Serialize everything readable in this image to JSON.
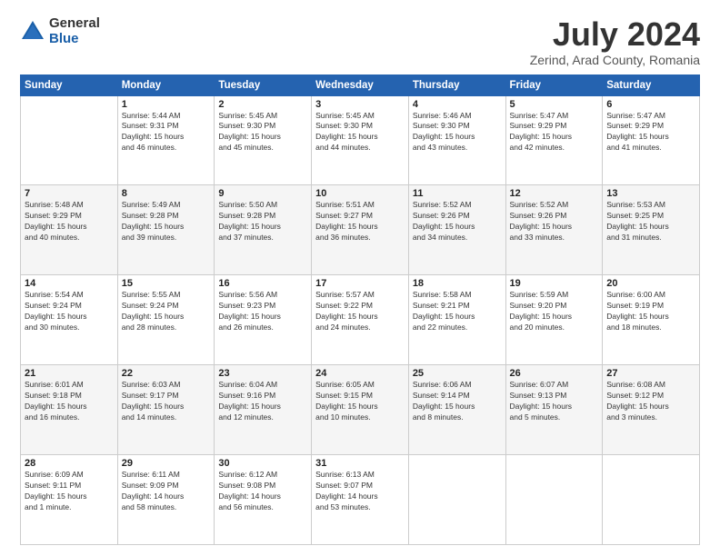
{
  "logo": {
    "general": "General",
    "blue": "Blue"
  },
  "title": "July 2024",
  "subtitle": "Zerind, Arad County, Romania",
  "weekdays": [
    "Sunday",
    "Monday",
    "Tuesday",
    "Wednesday",
    "Thursday",
    "Friday",
    "Saturday"
  ],
  "weeks": [
    [
      {
        "day": "",
        "info": ""
      },
      {
        "day": "1",
        "info": "Sunrise: 5:44 AM\nSunset: 9:31 PM\nDaylight: 15 hours\nand 46 minutes."
      },
      {
        "day": "2",
        "info": "Sunrise: 5:45 AM\nSunset: 9:30 PM\nDaylight: 15 hours\nand 45 minutes."
      },
      {
        "day": "3",
        "info": "Sunrise: 5:45 AM\nSunset: 9:30 PM\nDaylight: 15 hours\nand 44 minutes."
      },
      {
        "day": "4",
        "info": "Sunrise: 5:46 AM\nSunset: 9:30 PM\nDaylight: 15 hours\nand 43 minutes."
      },
      {
        "day": "5",
        "info": "Sunrise: 5:47 AM\nSunset: 9:29 PM\nDaylight: 15 hours\nand 42 minutes."
      },
      {
        "day": "6",
        "info": "Sunrise: 5:47 AM\nSunset: 9:29 PM\nDaylight: 15 hours\nand 41 minutes."
      }
    ],
    [
      {
        "day": "7",
        "info": "Sunrise: 5:48 AM\nSunset: 9:29 PM\nDaylight: 15 hours\nand 40 minutes."
      },
      {
        "day": "8",
        "info": "Sunrise: 5:49 AM\nSunset: 9:28 PM\nDaylight: 15 hours\nand 39 minutes."
      },
      {
        "day": "9",
        "info": "Sunrise: 5:50 AM\nSunset: 9:28 PM\nDaylight: 15 hours\nand 37 minutes."
      },
      {
        "day": "10",
        "info": "Sunrise: 5:51 AM\nSunset: 9:27 PM\nDaylight: 15 hours\nand 36 minutes."
      },
      {
        "day": "11",
        "info": "Sunrise: 5:52 AM\nSunset: 9:26 PM\nDaylight: 15 hours\nand 34 minutes."
      },
      {
        "day": "12",
        "info": "Sunrise: 5:52 AM\nSunset: 9:26 PM\nDaylight: 15 hours\nand 33 minutes."
      },
      {
        "day": "13",
        "info": "Sunrise: 5:53 AM\nSunset: 9:25 PM\nDaylight: 15 hours\nand 31 minutes."
      }
    ],
    [
      {
        "day": "14",
        "info": "Sunrise: 5:54 AM\nSunset: 9:24 PM\nDaylight: 15 hours\nand 30 minutes."
      },
      {
        "day": "15",
        "info": "Sunrise: 5:55 AM\nSunset: 9:24 PM\nDaylight: 15 hours\nand 28 minutes."
      },
      {
        "day": "16",
        "info": "Sunrise: 5:56 AM\nSunset: 9:23 PM\nDaylight: 15 hours\nand 26 minutes."
      },
      {
        "day": "17",
        "info": "Sunrise: 5:57 AM\nSunset: 9:22 PM\nDaylight: 15 hours\nand 24 minutes."
      },
      {
        "day": "18",
        "info": "Sunrise: 5:58 AM\nSunset: 9:21 PM\nDaylight: 15 hours\nand 22 minutes."
      },
      {
        "day": "19",
        "info": "Sunrise: 5:59 AM\nSunset: 9:20 PM\nDaylight: 15 hours\nand 20 minutes."
      },
      {
        "day": "20",
        "info": "Sunrise: 6:00 AM\nSunset: 9:19 PM\nDaylight: 15 hours\nand 18 minutes."
      }
    ],
    [
      {
        "day": "21",
        "info": "Sunrise: 6:01 AM\nSunset: 9:18 PM\nDaylight: 15 hours\nand 16 minutes."
      },
      {
        "day": "22",
        "info": "Sunrise: 6:03 AM\nSunset: 9:17 PM\nDaylight: 15 hours\nand 14 minutes."
      },
      {
        "day": "23",
        "info": "Sunrise: 6:04 AM\nSunset: 9:16 PM\nDaylight: 15 hours\nand 12 minutes."
      },
      {
        "day": "24",
        "info": "Sunrise: 6:05 AM\nSunset: 9:15 PM\nDaylight: 15 hours\nand 10 minutes."
      },
      {
        "day": "25",
        "info": "Sunrise: 6:06 AM\nSunset: 9:14 PM\nDaylight: 15 hours\nand 8 minutes."
      },
      {
        "day": "26",
        "info": "Sunrise: 6:07 AM\nSunset: 9:13 PM\nDaylight: 15 hours\nand 5 minutes."
      },
      {
        "day": "27",
        "info": "Sunrise: 6:08 AM\nSunset: 9:12 PM\nDaylight: 15 hours\nand 3 minutes."
      }
    ],
    [
      {
        "day": "28",
        "info": "Sunrise: 6:09 AM\nSunset: 9:11 PM\nDaylight: 15 hours\nand 1 minute."
      },
      {
        "day": "29",
        "info": "Sunrise: 6:11 AM\nSunset: 9:09 PM\nDaylight: 14 hours\nand 58 minutes."
      },
      {
        "day": "30",
        "info": "Sunrise: 6:12 AM\nSunset: 9:08 PM\nDaylight: 14 hours\nand 56 minutes."
      },
      {
        "day": "31",
        "info": "Sunrise: 6:13 AM\nSunset: 9:07 PM\nDaylight: 14 hours\nand 53 minutes."
      },
      {
        "day": "",
        "info": ""
      },
      {
        "day": "",
        "info": ""
      },
      {
        "day": "",
        "info": ""
      }
    ]
  ]
}
